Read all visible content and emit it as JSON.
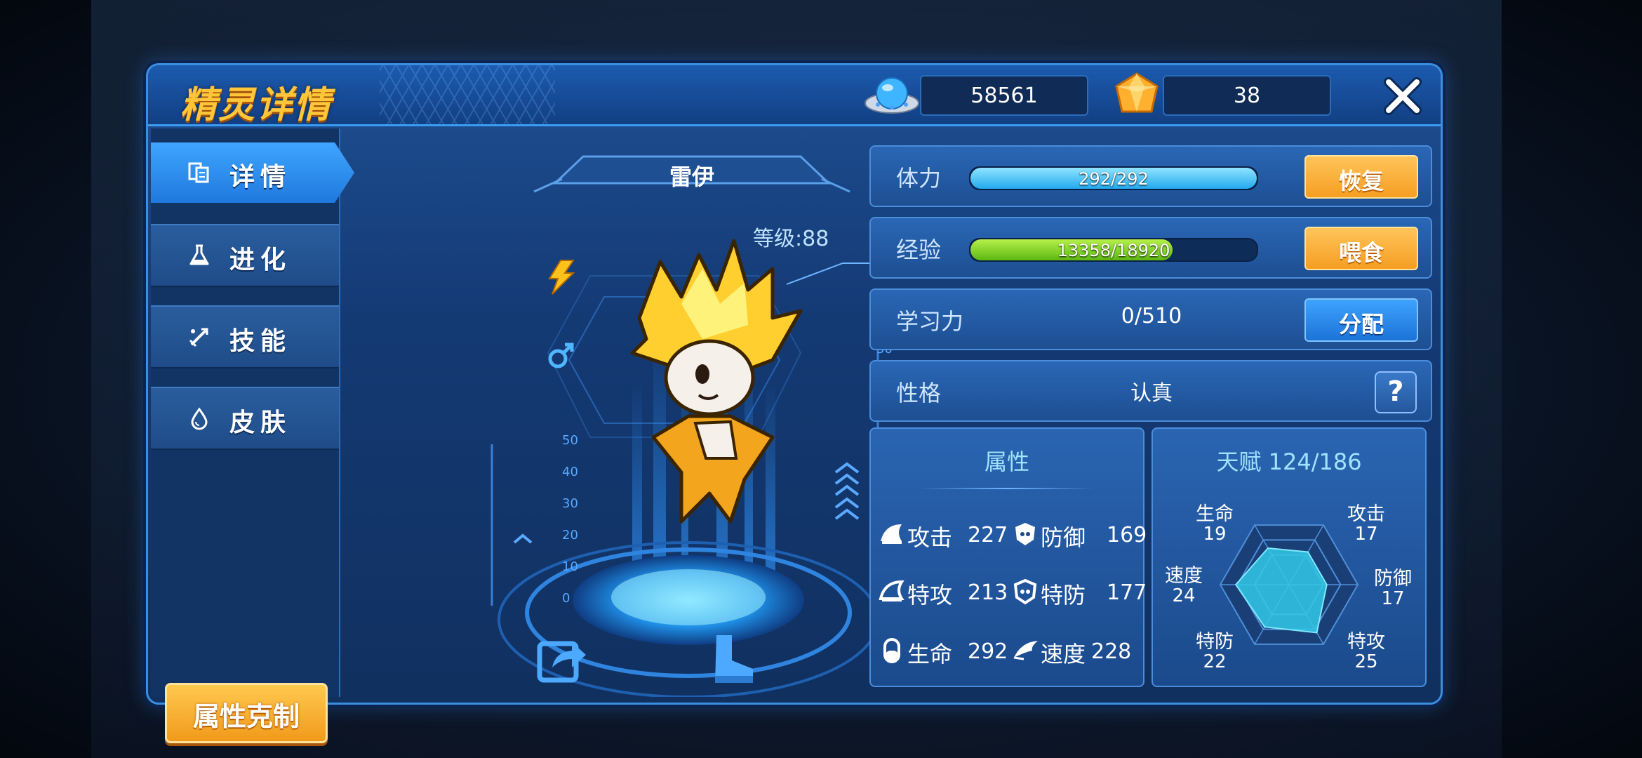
{
  "window": {
    "title": "精灵详情"
  },
  "currency": {
    "coins": "58561",
    "diamonds": "38"
  },
  "tabs": [
    {
      "label": "详情",
      "icon": "details-icon",
      "active": true
    },
    {
      "label": "进化",
      "icon": "flask-icon",
      "active": false
    },
    {
      "label": "技能",
      "icon": "sword-icon",
      "active": false
    },
    {
      "label": "皮肤",
      "icon": "drop-icon",
      "active": false
    }
  ],
  "counter_button": "属性克制",
  "pet": {
    "name": "雷伊",
    "level": "等级:88",
    "element": "lightning-icon",
    "gender": "male-icon"
  },
  "stats_rows": {
    "hp": {
      "label": "体力",
      "value": "292/292",
      "fraction": 1.0,
      "button": "恢复"
    },
    "exp": {
      "label": "经验",
      "value": "13358/18920",
      "fraction": 0.706,
      "button": "喂食"
    },
    "learn": {
      "label": "学习力",
      "value": "0/510",
      "button": "分配"
    },
    "nature": {
      "label": "性格",
      "value": "认真",
      "button": "?"
    }
  },
  "attributes": {
    "title": "属性",
    "items": [
      {
        "name": "攻击",
        "value": "227"
      },
      {
        "name": "防御",
        "value": "169"
      },
      {
        "name": "特攻",
        "value": "213"
      },
      {
        "name": "特防",
        "value": "177"
      },
      {
        "name": "生命",
        "value": "292"
      },
      {
        "name": "速度",
        "value": "228"
      }
    ]
  },
  "talent": {
    "title": "天赋 124/186",
    "items": [
      {
        "name": "生命",
        "value": "19"
      },
      {
        "name": "攻击",
        "value": "17"
      },
      {
        "name": "防御",
        "value": "17"
      },
      {
        "name": "特攻",
        "value": "25"
      },
      {
        "name": "特防",
        "value": "22"
      },
      {
        "name": "速度",
        "value": "24"
      }
    ],
    "max": 31
  },
  "gauge_ticks": [
    "50",
    "40",
    "30",
    "20",
    "10",
    "0"
  ],
  "colors": {
    "accent_orange": "#f59e22",
    "hp_bar": "#3fc8ff",
    "exp_bar": "#7ed321"
  }
}
